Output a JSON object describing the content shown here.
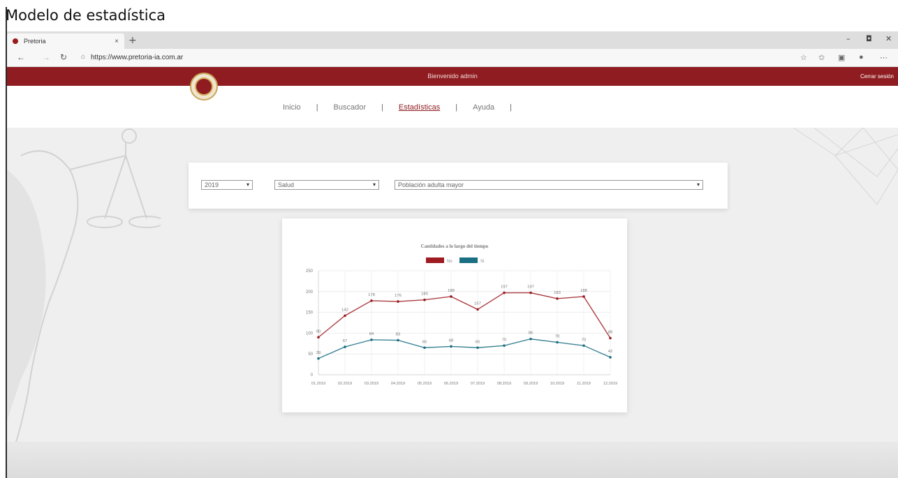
{
  "caption": "Modelo de estadística",
  "browser": {
    "tab_title": "Pretoria",
    "tab_close": "×",
    "new_tab": "+",
    "url": "https://www.pretoria-ia.com.ar"
  },
  "header": {
    "welcome": "Bienvenido   admin",
    "logout": "Cerrar sesión"
  },
  "nav": {
    "items": [
      {
        "label": "Inicio"
      },
      {
        "label": "Buscador"
      },
      {
        "label": "Estadísticas"
      },
      {
        "label": "Ayuda"
      }
    ],
    "active": "Estadísticas",
    "separator": "|"
  },
  "filters": {
    "year": "2019",
    "category": "Salud",
    "subcategory": "Población adulta mayor"
  },
  "colors": {
    "brand": "#8e1c20",
    "series_no": "#9e1b21",
    "series_si": "#1a6f82"
  },
  "chart_data": {
    "type": "line",
    "title": "Cantidades a lo largo del tiempo",
    "categories": [
      "01.2019",
      "02.2019",
      "03.2019",
      "04.2019",
      "05.2019",
      "06.2019",
      "07.2019",
      "08.2019",
      "09.2019",
      "10.2019",
      "11.2019",
      "12.2019"
    ],
    "series": [
      {
        "name": "No",
        "values": [
          90,
          142,
          178,
          176,
          180,
          188,
          157,
          197,
          197,
          183,
          188,
          88
        ]
      },
      {
        "name": "Si",
        "values": [
          39,
          67,
          84,
          83,
          65,
          68,
          65,
          70,
          86,
          78,
          70,
          42
        ]
      }
    ],
    "ylim": [
      0,
      250
    ],
    "yticks": [
      0,
      50,
      100,
      150,
      200,
      250
    ],
    "grid": true,
    "legend": "top-center"
  }
}
